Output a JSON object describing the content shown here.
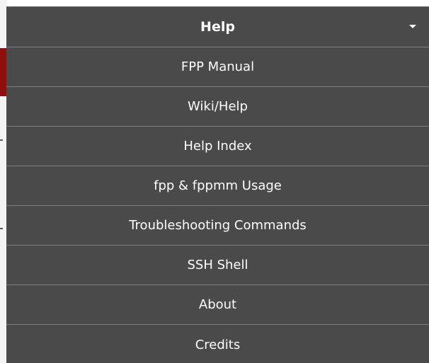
{
  "menu": {
    "header_label": "Help",
    "items": [
      {
        "label": "FPP Manual"
      },
      {
        "label": "Wiki/Help"
      },
      {
        "label": "Help Index"
      },
      {
        "label": "fpp & fppmm Usage"
      },
      {
        "label": "Troubleshooting Commands"
      },
      {
        "label": "SSH Shell"
      },
      {
        "label": "About"
      },
      {
        "label": "Credits"
      }
    ]
  },
  "colors": {
    "menu_background": "#4a4a4a",
    "divider": "#7d7d7d",
    "text": "#ffffff",
    "page_accent": "#8f0f0f"
  },
  "icons": {
    "dropdown_caret": "chevron-down-icon"
  }
}
